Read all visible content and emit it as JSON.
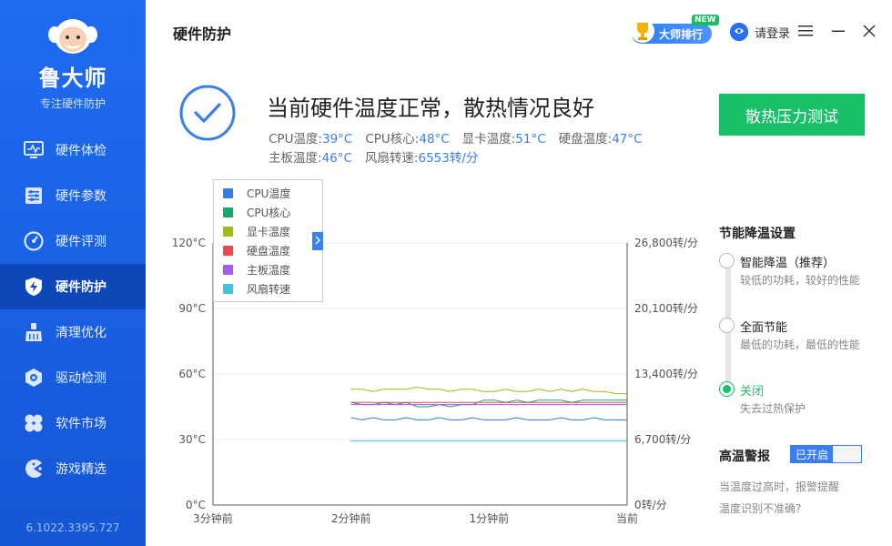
{
  "sidebar": {
    "app_name": "鲁大师",
    "app_tagline": "专注硬件防护",
    "version": "6.1022.3395.727",
    "items": [
      {
        "label": "硬件体检",
        "icon": "monitor-pulse-icon",
        "active": false
      },
      {
        "label": "硬件参数",
        "icon": "sliders-icon",
        "active": false
      },
      {
        "label": "硬件评测",
        "icon": "speedometer-icon",
        "active": false
      },
      {
        "label": "硬件防护",
        "icon": "shield-bolt-icon",
        "active": true
      },
      {
        "label": "清理优化",
        "icon": "broom-icon",
        "active": false
      },
      {
        "label": "驱动检测",
        "icon": "gear-hex-icon",
        "active": false
      },
      {
        "label": "软件市场",
        "icon": "clover-icon",
        "active": false
      },
      {
        "label": "游戏精选",
        "icon": "pacman-icon",
        "active": false
      }
    ]
  },
  "header": {
    "title": "硬件防护",
    "rank_label": "大师排行",
    "new_tag": "NEW",
    "login_label": "请登录"
  },
  "status": {
    "title": "当前硬件温度正常，散热情况良好",
    "readings": [
      {
        "label": "CPU温度:",
        "value": "39°C"
      },
      {
        "label": "CPU核心:",
        "value": "48°C"
      },
      {
        "label": "显卡温度:",
        "value": "51°C"
      },
      {
        "label": "硬盘温度:",
        "value": "47°C"
      },
      {
        "label": "主板温度:",
        "value": "46°C"
      },
      {
        "label": "风扇转速:",
        "value": "6553转/分"
      }
    ],
    "stress_button": "散热压力测试"
  },
  "chart_data": {
    "type": "line",
    "x_ticks": [
      "3分钟前",
      "2分钟前",
      "1分钟前",
      "当前"
    ],
    "left_ticks": [
      "0°C",
      "30°C",
      "60°C",
      "90°C",
      "120°C"
    ],
    "right_ticks": [
      "0转/分",
      "6,700转/分",
      "13,400转/分",
      "20,100转/分",
      "26,800转/分"
    ],
    "ylim": [
      0,
      120
    ],
    "y2lim": [
      0,
      26800
    ],
    "x_range_minutes": [
      -3,
      0
    ],
    "data_start_minute": -2,
    "series": [
      {
        "name": "CPU温度",
        "color": "#2f7fe4",
        "axis": "left",
        "values": [
          40,
          39,
          40,
          39,
          39,
          40,
          39,
          39,
          40,
          39,
          39,
          40,
          39,
          39,
          39,
          40,
          39,
          39,
          39,
          40,
          39,
          39,
          40,
          39,
          39,
          39
        ]
      },
      {
        "name": "CPU核心",
        "color": "#16a86a",
        "axis": "left",
        "values": [
          47,
          46,
          46,
          47,
          46,
          47,
          45,
          45,
          46,
          45,
          46,
          46,
          48,
          48,
          47,
          48,
          47,
          48,
          48,
          48,
          47,
          48,
          48,
          48,
          48,
          48
        ]
      },
      {
        "name": "显卡温度",
        "color": "#a4b91a",
        "axis": "left",
        "values": [
          53,
          53,
          52,
          53,
          53,
          53,
          54,
          53,
          53,
          52,
          53,
          53,
          52,
          52,
          53,
          52,
          52,
          53,
          52,
          53,
          52,
          53,
          52,
          52,
          51,
          51
        ]
      },
      {
        "name": "硬盘温度",
        "color": "#e84a4a",
        "axis": "left",
        "values": [
          47,
          47,
          47,
          47,
          47,
          47,
          47,
          47,
          47,
          47,
          47,
          47,
          47,
          47,
          47,
          47,
          47,
          47,
          47,
          47,
          47,
          47,
          47,
          47,
          47,
          47
        ]
      },
      {
        "name": "主板温度",
        "color": "#a25cf0",
        "axis": "left",
        "values": [
          46,
          46,
          46,
          46,
          46,
          46,
          46,
          46,
          46,
          46,
          46,
          46,
          46,
          46,
          46,
          46,
          46,
          46,
          46,
          46,
          46,
          46,
          46,
          46,
          46,
          46
        ]
      },
      {
        "name": "风扇转速",
        "color": "#3fc3e0",
        "axis": "right",
        "values": [
          6553,
          6553,
          6553,
          6553,
          6553,
          6553,
          6553,
          6553,
          6553,
          6553,
          6553,
          6553,
          6553,
          6553,
          6553,
          6553,
          6553,
          6553,
          6553,
          6553,
          6553,
          6553,
          6553,
          6553,
          6553,
          6553
        ]
      }
    ],
    "legend_position": "top-left",
    "grid": true
  },
  "settings": {
    "title": "节能降温设置",
    "options": [
      {
        "label": "智能降温（推荐）",
        "desc": "较低的功耗，较好的性能",
        "checked": false
      },
      {
        "label": "全面节能",
        "desc": "最低的功耗，最低的性能",
        "checked": false
      },
      {
        "label": "关闭",
        "desc": "失去过热保护",
        "checked": true
      }
    ]
  },
  "alarm": {
    "title": "高温警报",
    "toggle_label": "已开启",
    "desc": "当温度过高时，报警提醒",
    "link": "温度识别不准确?"
  },
  "colors": {
    "sidebar": "#1f6cf0",
    "sidebar_active": "#0d47b8",
    "accent_blue": "#3a7ef0",
    "accent_green": "#18c06a"
  }
}
